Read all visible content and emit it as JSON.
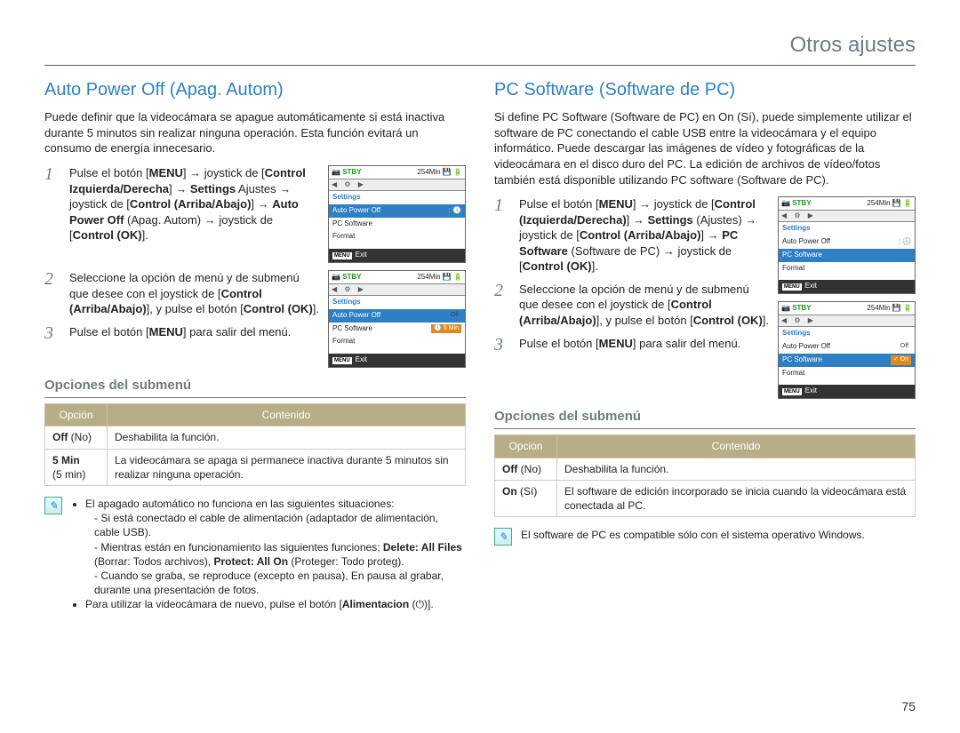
{
  "header": {
    "title": "Otros ajustes"
  },
  "page_number": "75",
  "left": {
    "heading": "Auto Power Off (Apag. Autom)",
    "intro": "Puede definir que la videocámara se apague automáticamente si está inactiva durante 5 minutos sin realizar ninguna operación. Esta función evitará un consumo de energía innecesario.",
    "step1_pre": "Pulse el botón [",
    "step1_menu": "MENU",
    "step1_p2": "] → joystick de [",
    "step1_cid": "Control Izquierda/Derecha",
    "step1_p3": "] → ",
    "step1_settings": "Settings",
    "step1_p4": " Ajustes → joystick de [",
    "step1_cad": "Control (Arriba/Abajo)",
    "step1_p5": "] → ",
    "step1_apo": "Auto Power Off",
    "step1_p6": " (Apag. Autom) → joystick de [",
    "step1_cok": "Control (OK)",
    "step1_p7": "].",
    "step2_a": "Seleccione la opción de menú y de submenú que desee con el joystick de [",
    "step2_cad": "Control (Arriba/Abajo)",
    "step2_b": "], y pulse el botón [",
    "step2_cok": "Control (OK)",
    "step2_c": "].",
    "step3_a": "Pulse el botón [",
    "step3_menu": "MENU",
    "step3_b": "] para salir del menú.",
    "sub_head": "Opciones del submenú",
    "table": {
      "h1": "Opción",
      "h2": "Contenido",
      "r1c1a": "Off",
      "r1c1b": " (No)",
      "r1c2": "Deshabilita la función.",
      "r2c1a": "5 Min",
      "r2c1b": "(5 min)",
      "r2c2": "La videocámara se apaga si permanece inactiva durante 5 minutos sin realizar ninguna operación."
    },
    "notes": {
      "n1": "El apagado automático no funciona en las siguientes situaciones:",
      "n1a": "Si está conectado el cable de alimentación (adaptador de alimentación, cable USB).",
      "n1b_pre": "Mientras están en funcionamiento las siguientes funciones; ",
      "n1b_b1": "Delete: All Files",
      "n1b_mid": " (Borrar: Todos archivos), ",
      "n1b_b2": "Protect: All On",
      "n1b_post": " (Proteger: Todo proteg).",
      "n1c": "Cuando se graba, se reproduce (excepto en pausa), En pausa al grabar, durante una presentación de fotos.",
      "n2_pre": "Para utilizar la videocámara de nuevo, pulse el botón [",
      "n2_b": "Alimentacion",
      "n2_post": " (⏻)]."
    },
    "shot1": {
      "stby": "STBY",
      "time": "254Min",
      "settings": "Settings",
      "item1": "Auto Power Off",
      "item2": "PC Software",
      "item3": "Format",
      "exit": "Exit",
      "menu": "MENU"
    },
    "shot2": {
      "stby": "STBY",
      "time": "254Min",
      "settings": "Settings",
      "item1": "Auto Power Off",
      "val1": "Off",
      "item2": "PC Software",
      "val2": "5 Min",
      "item3": "Format",
      "exit": "Exit",
      "menu": "MENU"
    }
  },
  "right": {
    "heading": "PC Software (Software de PC)",
    "intro": "Si define PC Software (Software de PC) en On (Sí), puede simplemente utilizar el software de PC conectando el cable USB entre la videocámara y el equipo informático. Puede descargar las imágenes de vídeo y fotográficas de la videocámara en el disco duro del PC. La edición de archivos de vídeo/fotos también está disponible utilizando PC software (Software de PC).",
    "step1_pre": "Pulse el botón [",
    "step1_menu": "MENU",
    "step1_p2": "] → joystick de [",
    "step1_cid": "Control (Izquierda/Derecha)",
    "step1_p3": "] → ",
    "step1_settings": "Settings",
    "step1_p4": " (Ajustes) → joystick de [",
    "step1_cad": "Control (Arriba/Abajo)",
    "step1_p5": "] → ",
    "step1_apo": "PC Software",
    "step1_p6": " (Software de PC) → joystick de [",
    "step1_cok": "Control (OK)",
    "step1_p7": "].",
    "step2_a": "Seleccione la opción de menú y de submenú que desee con el joystick de [",
    "step2_cad": "Control (Arriba/Abajo)",
    "step2_b": "], y pulse el botón [",
    "step2_cok": "Control (OK)",
    "step2_c": "].",
    "step3_a": "Pulse el botón [",
    "step3_menu": "MENU",
    "step3_b": "] para salir del menú.",
    "sub_head": "Opciones del submenú",
    "table": {
      "h1": "Opción",
      "h2": "Contenido",
      "r1c1a": "Off",
      "r1c1b": " (No)",
      "r1c2": "Deshabilita la función.",
      "r2c1a": "On",
      "r2c1b": " (Sí)",
      "r2c2": "El software de edición incorporado se inicia cuando la videocámara está conectada al PC."
    },
    "note": "El software de PC es compatible sólo con el sistema operativo Windows.",
    "shot1": {
      "stby": "STBY",
      "time": "254Min",
      "settings": "Settings",
      "item1": "Auto Power Off",
      "item2": "PC Software",
      "item3": "Format",
      "exit": "Exit",
      "menu": "MENU"
    },
    "shot2": {
      "stby": "STBY",
      "time": "254Min",
      "settings": "Settings",
      "item1": "Auto Power Off",
      "val1": "Off",
      "item2": "PC Software",
      "val2": "On",
      "item3": "Format",
      "exit": "Exit",
      "menu": "MENU"
    }
  }
}
